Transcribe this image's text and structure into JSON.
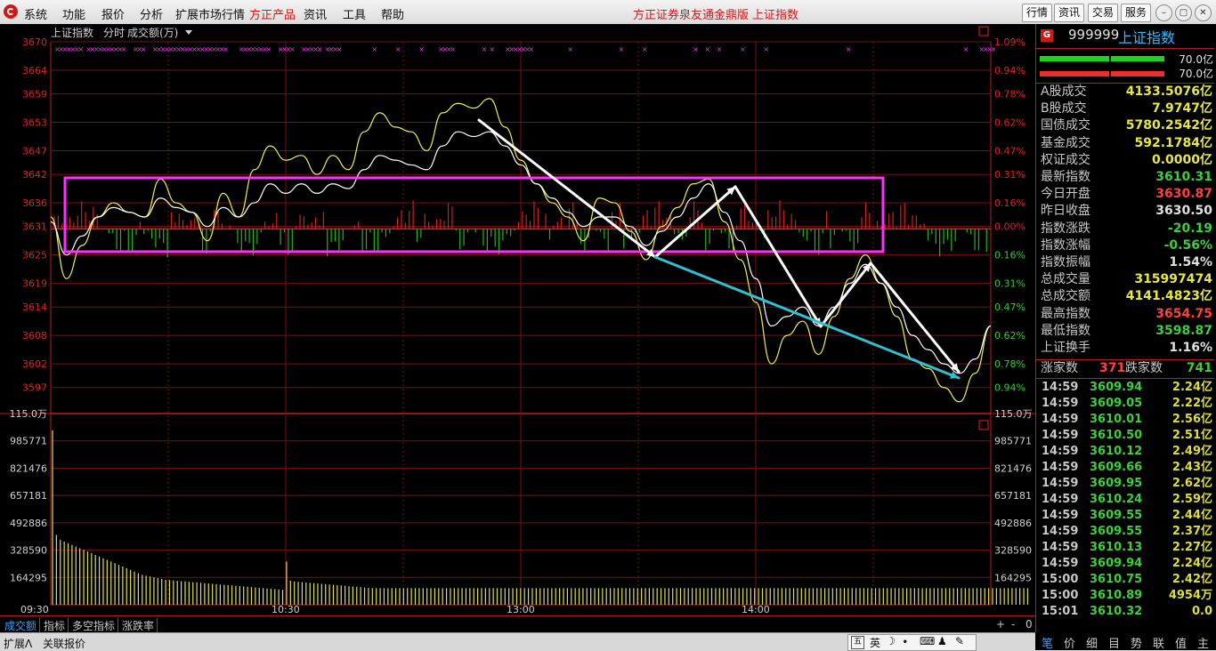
{
  "menu": {
    "left": [
      "系统",
      "功能",
      "报价",
      "分析",
      "扩展市场行情",
      "方正产品",
      "资讯",
      "工具",
      "帮助"
    ],
    "center": [
      "方正证券泉友通金鼎版",
      "上证指数"
    ],
    "right_buttons": [
      "行情",
      "资讯",
      "交易",
      "服务"
    ]
  },
  "chart": {
    "header": {
      "name": "上证指数",
      "mode": "分时",
      "indicator": "成交额(万)"
    },
    "price_ticks": [
      "3670",
      "3664",
      "3659",
      "3653",
      "3647",
      "3642",
      "3636",
      "3631",
      "3625",
      "3619",
      "3614",
      "3608",
      "3602",
      "3597"
    ],
    "pct_ticks": [
      "1.09%",
      "0.94%",
      "0.78%",
      "0.62%",
      "0.47%",
      "0.31%",
      "0.16%",
      "0.00%",
      "0.16%",
      "0.31%",
      "0.47%",
      "0.62%",
      "0.78%",
      "0.94%"
    ],
    "vol_ticks": [
      "115.0万",
      "985771",
      "821476",
      "657181",
      "492886",
      "328590",
      "164295"
    ],
    "time_ticks": [
      "09:30",
      "10:30",
      "13:00",
      "14:00"
    ],
    "prev_close": 3630.5,
    "price_max": 3670,
    "price_min": 3591.5,
    "vol_max": 1150000
  },
  "chart_data": {
    "type": "line",
    "series": [
      {
        "x": [
          0,
          4,
          8,
          12,
          16,
          20,
          24,
          28,
          32,
          36,
          40,
          44,
          48,
          52,
          56,
          60,
          64,
          68,
          72,
          76,
          80,
          84,
          88,
          92,
          96,
          100,
          104,
          108,
          112,
          116,
          120,
          124,
          128,
          132,
          136,
          140,
          144,
          148,
          152,
          156,
          160,
          164,
          168,
          172,
          176,
          180,
          184,
          188,
          192,
          196,
          200,
          204,
          208,
          212,
          216,
          220,
          224,
          228,
          232,
          236,
          240
        ],
        "y": [
          3633,
          3620,
          3627,
          3633,
          3636,
          3634,
          3633,
          3641,
          3636,
          3634,
          3628,
          3638,
          3633,
          3643,
          3648,
          3645,
          3646,
          3642,
          3646,
          3643,
          3651,
          3655,
          3652,
          3651,
          3647,
          3655,
          3657,
          3656,
          3658,
          3652,
          3645,
          3640,
          3636,
          3633,
          3628,
          3637,
          3636,
          3630,
          3624,
          3631,
          3635,
          3640,
          3641,
          3632,
          3624,
          3615,
          3602,
          3608,
          3611,
          3604,
          3612,
          3620,
          3625,
          3619,
          3612,
          3603,
          3601,
          3597,
          3594,
          3600,
          3610
        ]
      },
      {
        "x": [
          0,
          4,
          8,
          12,
          16,
          20,
          24,
          28,
          32,
          36,
          40,
          44,
          48,
          52,
          56,
          60,
          64,
          68,
          72,
          76,
          80,
          84,
          88,
          92,
          96,
          100,
          104,
          108,
          112,
          116,
          120,
          124,
          128,
          132,
          136,
          140,
          144,
          148,
          152,
          156,
          160,
          164,
          168,
          172,
          176,
          180,
          184,
          188,
          192,
          196,
          200,
          204,
          208,
          212,
          216,
          220,
          224,
          228,
          232,
          236,
          240
        ],
        "y": [
          3632,
          3625,
          3629,
          3633,
          3635,
          3634,
          3633,
          3637,
          3635,
          3634,
          3631,
          3635,
          3633,
          3636,
          3640,
          3638,
          3640,
          3638,
          3640,
          3639,
          3643,
          3646,
          3645,
          3644,
          3643,
          3648,
          3651,
          3650,
          3651,
          3648,
          3644,
          3640,
          3637,
          3634,
          3631,
          3633,
          3633,
          3631,
          3627,
          3630,
          3633,
          3637,
          3640,
          3634,
          3628,
          3620,
          3610,
          3612,
          3614,
          3610,
          3614,
          3619,
          3623,
          3619,
          3614,
          3608,
          3605,
          3602,
          3600,
          3603,
          3610
        ]
      }
    ],
    "volume": [
      1050000,
      420000,
      390000,
      380000,
      370000,
      360000,
      350000,
      340000,
      330000,
      320000,
      310000,
      300000,
      290000,
      280000,
      270000,
      260000,
      250000,
      240000,
      230000,
      220000,
      210000,
      200000,
      190000,
      180000,
      175000,
      170000,
      165000,
      160000,
      155000,
      150000,
      148000,
      146000,
      144000,
      142000,
      140000,
      138000,
      136000,
      134000,
      132000,
      130000,
      128000,
      126000,
      124000,
      122000,
      120000,
      118000,
      116000,
      114000,
      112000,
      110000,
      108000,
      106000,
      104000,
      102000,
      100000,
      98000,
      96000,
      94000,
      92000,
      90000,
      260000,
      145000,
      140000,
      138000,
      136000,
      134000,
      132000,
      130000,
      128000,
      126000,
      124000,
      122000,
      120000,
      118000,
      116000,
      114000,
      112000,
      110000,
      108000,
      106000,
      104000,
      102000,
      100000,
      100000,
      100000,
      100000,
      100000,
      100000,
      100000,
      100000,
      100000,
      100000,
      100000,
      100000,
      100000,
      100000,
      100000,
      100000,
      100000,
      100000,
      100000,
      100000,
      100000,
      100000,
      100000,
      100000,
      100000,
      100000,
      100000,
      100000,
      100000,
      100000,
      100000,
      100000,
      100000,
      100000,
      100000,
      100000,
      100000,
      100000,
      100000,
      100000,
      100000,
      100000,
      100000,
      100000,
      100000,
      100000,
      100000,
      100000,
      100000,
      100000,
      100000,
      100000,
      100000,
      100000,
      100000,
      100000,
      100000,
      100000,
      100000,
      100000,
      100000,
      100000,
      100000,
      100000,
      100000,
      100000,
      100000,
      100000,
      100000,
      100000,
      100000,
      100000,
      100000,
      100000,
      100000,
      100000,
      100000,
      100000,
      100000,
      100000,
      100000,
      100000,
      100000,
      100000,
      100000,
      100000,
      100000,
      100000,
      100000,
      100000,
      100000,
      100000,
      100000,
      100000,
      100000,
      100000,
      100000,
      100000,
      100000,
      100000,
      100000,
      100000,
      100000,
      100000,
      100000,
      100000,
      100000,
      100000,
      100000,
      100000,
      100000,
      100000,
      100000,
      100000,
      100000,
      100000,
      100000,
      100000,
      100000,
      100000,
      100000,
      100000,
      100000,
      100000,
      100000,
      100000,
      100000,
      100000,
      100000,
      100000,
      100000,
      100000,
      100000,
      100000,
      100000,
      100000,
      100000,
      100000,
      100000,
      100000,
      100000,
      100000,
      100000,
      100000,
      100000,
      100000,
      100000,
      100000,
      100000,
      100000,
      100000,
      100000,
      100000,
      100000,
      100000,
      100000,
      100000,
      100000,
      100000,
      100000,
      100000,
      100000,
      100000,
      100000,
      100000,
      100000,
      100000,
      100000,
      100000
    ],
    "ylim": [
      3591.5,
      3670
    ]
  },
  "right_panel": {
    "code": "999999",
    "name": "上证指数",
    "bar_labels": [
      "70.0亿",
      "70.0亿"
    ],
    "rows": [
      {
        "label": "A股成交",
        "value": "4133.5076亿",
        "color": "#e8e840"
      },
      {
        "label": "B股成交",
        "value": "7.9747亿",
        "color": "#e8e840"
      },
      {
        "label": "国债成交",
        "value": "5780.2542亿",
        "color": "#e8e840"
      },
      {
        "label": "基金成交",
        "value": "592.1784亿",
        "color": "#e8e840"
      },
      {
        "label": "权证成交",
        "value": "0.0000亿",
        "color": "#e8e840"
      },
      {
        "label": "最新指数",
        "value": "3610.31",
        "color": "#3ccf3c"
      },
      {
        "label": "今日开盘",
        "value": "3630.87",
        "color": "#ff4040"
      },
      {
        "label": "昨日收盘",
        "value": "3630.50",
        "color": "#e0e0e0"
      },
      {
        "label": "指数涨跌",
        "value": "-20.19",
        "color": "#3ccf3c"
      },
      {
        "label": "指数涨幅",
        "value": "-0.56%",
        "color": "#3ccf3c"
      },
      {
        "label": "指数振幅",
        "value": "1.54%",
        "color": "#e0e0e0"
      },
      {
        "label": "总成交量",
        "value": "315997474",
        "color": "#e8e840"
      },
      {
        "label": "总成交额",
        "value": "4141.4823亿",
        "color": "#e8e840"
      },
      {
        "label": "最高指数",
        "value": "3654.75",
        "color": "#ff4040"
      },
      {
        "label": "最低指数",
        "value": "3598.87",
        "color": "#3ccf3c"
      },
      {
        "label": "上证换手",
        "value": "1.16%",
        "color": "#e0e0e0"
      }
    ],
    "up_label": "涨家数",
    "up_value": "371",
    "down_label": "跌家数",
    "down_value": "741",
    "ticks": [
      {
        "t": "14:59",
        "p": "3609.94",
        "v": "2.24亿",
        "pc": "#3ccf3c"
      },
      {
        "t": "14:59",
        "p": "3609.05",
        "v": "2.22亿",
        "pc": "#3ccf3c"
      },
      {
        "t": "14:59",
        "p": "3610.01",
        "v": "2.56亿",
        "pc": "#3ccf3c"
      },
      {
        "t": "14:59",
        "p": "3610.50",
        "v": "2.51亿",
        "pc": "#3ccf3c"
      },
      {
        "t": "14:59",
        "p": "3610.12",
        "v": "2.49亿",
        "pc": "#3ccf3c"
      },
      {
        "t": "14:59",
        "p": "3609.66",
        "v": "2.43亿",
        "pc": "#3ccf3c"
      },
      {
        "t": "14:59",
        "p": "3609.95",
        "v": "2.62亿",
        "pc": "#3ccf3c"
      },
      {
        "t": "14:59",
        "p": "3610.24",
        "v": "2.59亿",
        "pc": "#3ccf3c"
      },
      {
        "t": "14:59",
        "p": "3609.55",
        "v": "2.44亿",
        "pc": "#3ccf3c"
      },
      {
        "t": "14:59",
        "p": "3609.55",
        "v": "2.37亿",
        "pc": "#3ccf3c"
      },
      {
        "t": "14:59",
        "p": "3610.13",
        "v": "2.27亿",
        "pc": "#3ccf3c"
      },
      {
        "t": "14:59",
        "p": "3609.94",
        "v": "2.24亿",
        "pc": "#3ccf3c"
      },
      {
        "t": "15:00",
        "p": "3610.75",
        "v": "2.42亿",
        "pc": "#3ccf3c"
      },
      {
        "t": "15:00",
        "p": "3610.89",
        "v": "4954万",
        "pc": "#3ccf3c"
      },
      {
        "t": "15:01",
        "p": "3610.32",
        "v": "0.0",
        "pc": "#3ccf3c"
      }
    ]
  },
  "bottom_tabs": [
    "成交额",
    "指标",
    "多空指标",
    "涨跌率"
  ],
  "status": {
    "left": [
      "扩展Λ",
      "关联报价"
    ],
    "ime": "英"
  },
  "right_tabs": [
    "笔",
    "价",
    "细",
    "目",
    "势",
    "联",
    "值",
    "主"
  ],
  "corner": {
    "plus": "+",
    "minus": "-",
    "zero": "0"
  }
}
